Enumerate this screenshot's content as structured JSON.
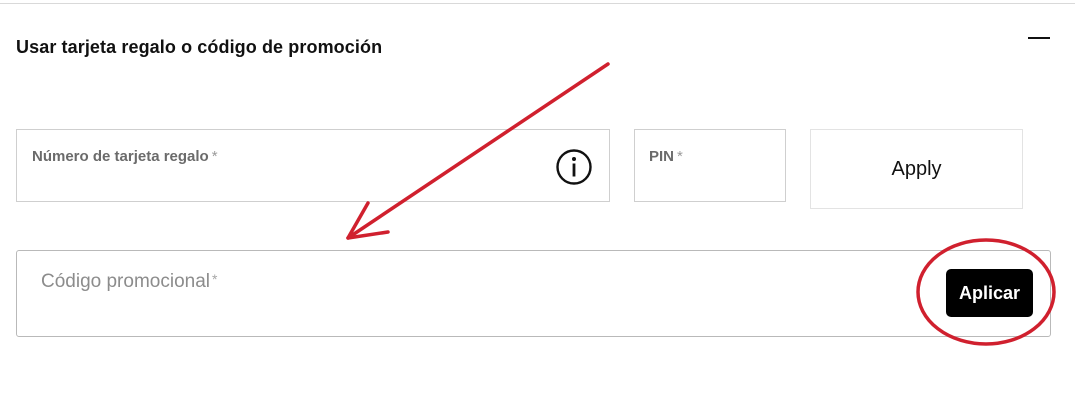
{
  "section": {
    "title": "Usar tarjeta regalo o código de promoción",
    "collapse_icon": "minus-icon"
  },
  "gift_card": {
    "label": "Número de tarjeta regalo",
    "required_mark": "*",
    "info_icon": "info-icon"
  },
  "pin": {
    "label": "PIN",
    "required_mark": "*"
  },
  "apply_button": {
    "label": "Apply"
  },
  "promo": {
    "placeholder": "Código promocional",
    "required_mark": "*"
  },
  "aplicar_button": {
    "label": "Aplicar"
  },
  "annotations": {
    "color": "#d0202e",
    "items": [
      "arrow-annotation",
      "circle-annotation"
    ]
  }
}
